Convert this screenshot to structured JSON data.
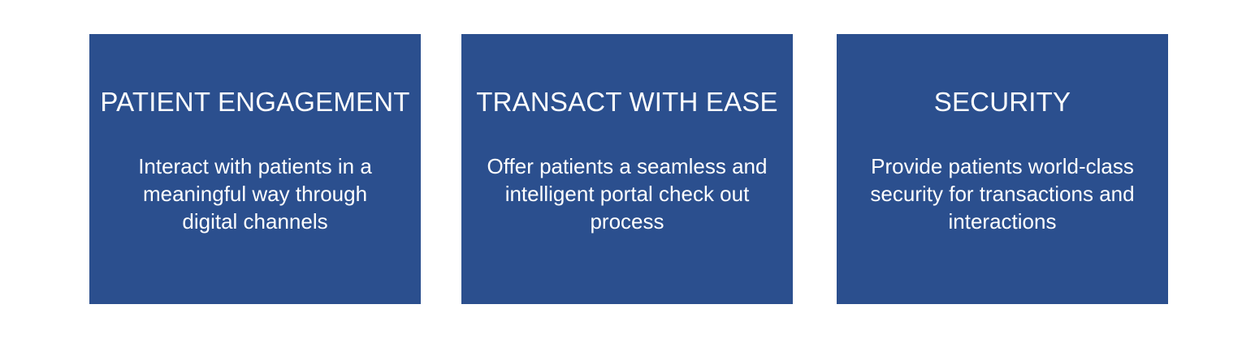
{
  "cards": [
    {
      "title": "PATIENT ENGAGEMENT",
      "lines": [
        "Interact with patients in a",
        "meaningful way through",
        "digital channels"
      ]
    },
    {
      "title": "TRANSACT WITH EASE",
      "lines": [
        "Offer patients a seamless and",
        "intelligent portal check out",
        "process"
      ]
    },
    {
      "title": "SECURITY",
      "lines": [
        "Provide patients world-class",
        "security for transactions and",
        "interactions"
      ]
    }
  ],
  "colors": {
    "card_background": "#2b4f8e",
    "text": "#ffffff",
    "page_background": "#ffffff"
  }
}
